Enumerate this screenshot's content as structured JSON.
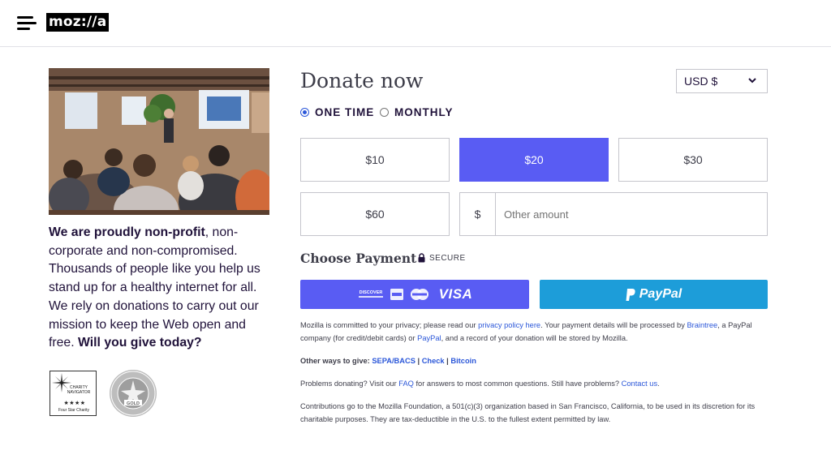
{
  "header": {
    "logo": "moz://a"
  },
  "left": {
    "pitch_bold_1": "We are proudly non-profit",
    "pitch_text": ", non-corporate and non-compromised. Thousands of people like you help us stand up for a healthy internet for all. We rely on donations to carry out our mission to keep the Web open and free. ",
    "pitch_bold_2": "Will you give today?",
    "charity_navigator": {
      "name": "CHARITY NAVIGATOR",
      "stars": "★★★★",
      "rating": "Four Star Charity"
    },
    "guidestar_badge": "SEAL OF TRANSPARENCY GOLD"
  },
  "donate": {
    "title": "Donate now",
    "currency": "USD $",
    "frequency": {
      "one_time": "ONE TIME",
      "monthly": "MONTHLY",
      "selected": "one_time"
    },
    "amounts": [
      "$10",
      "$20",
      "$30",
      "$60"
    ],
    "selected_amount": "$20",
    "other_prefix": "$",
    "other_placeholder": "Other amount"
  },
  "payment": {
    "title": "Choose Payment",
    "secure": "SECURE",
    "discover": "DISCOVER",
    "visa": "VISA",
    "paypal": "PayPal"
  },
  "legal": {
    "p1_a": "Mozilla is committed to your privacy; please read our ",
    "p1_link1": "privacy policy here",
    "p1_b": ". Your payment details will be processed by ",
    "p1_link2": "Braintree",
    "p1_c": ", a PayPal company (for credit/debit cards) or ",
    "p1_link3": "PayPal",
    "p1_d": ", and a record of your donation will be stored by Mozilla.",
    "p2_label": "Other ways to give: ",
    "p2_link1": "SEPA/BACS",
    "p2_sep": " | ",
    "p2_link2": "Check",
    "p2_link3": "Bitcoin",
    "p3_a": "Problems donating? Visit our ",
    "p3_link1": "FAQ",
    "p3_b": " for answers to most common questions. Still have problems? ",
    "p3_link2": "Contact us",
    "p3_c": ".",
    "p4": "Contributions go to the Mozilla Foundation, a 501(c)(3) organization based in San Francisco, California, to be used in its discretion for its charitable purposes. They are tax-deductible in the U.S. to the fullest extent permitted by law."
  },
  "colors": {
    "accent": "#595cf3",
    "paypal": "#1d9dd9",
    "link": "#2b57d9"
  }
}
